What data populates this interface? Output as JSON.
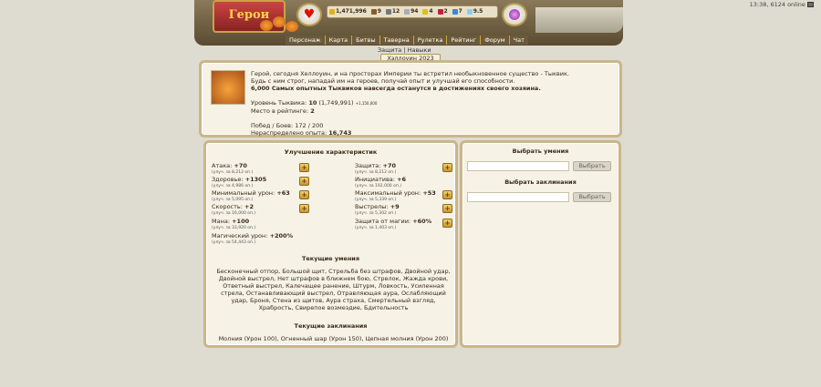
{
  "topbar": {
    "time_online": "13:38, 6124 online"
  },
  "header": {
    "logo_text": "Герои",
    "resources": [
      "1,471,996",
      "9",
      "12",
      "94",
      "4",
      "2",
      "7",
      "9.5"
    ]
  },
  "nav": [
    "Персонаж",
    "Карта",
    "Битвы",
    "Таверна",
    "Рулетка",
    "Рейтинг",
    "Форум",
    "Чат"
  ],
  "subnav": "Защита | Навыки",
  "page_title": "Хэллоуин 2023",
  "hero": {
    "line1": "Герой, сегодня Хеллоуин, и на просторах Империи ты встретил необыкновенное существо - Тыквик.",
    "line2": "Будь с ним строг, нападай им на героев, получай опыт и улучшай его способности.",
    "line3": "6,000 Самых опытных Тыквиков навсегда останутся в достижениях своего хозяина.",
    "level_label": "Уровень Тыквика:",
    "level_value": "10",
    "level_exp": "(1,749,991)",
    "level_next": "+1,150,000",
    "rank_label": "Место в рейтинге:",
    "rank_value": "2",
    "wins_label": "Побед / Боев:",
    "wins_value": "172 / 200",
    "unspent_label": "Нераспределено опыта:",
    "unspent_value": "16,743"
  },
  "upgrades": {
    "title": "Улучшение характеристик",
    "left": [
      {
        "label": "Атака:",
        "value": "+70",
        "cost": "(улуч. за 8,212 оп.)"
      },
      {
        "label": "Здоровье:",
        "value": "+1305",
        "cost": "(улуч. за 4,986 оп.)"
      },
      {
        "label": "Минимальный урон:",
        "value": "+63",
        "cost": "(улуч. за 5,095 оп.)"
      },
      {
        "label": "Скорость:",
        "value": "+2",
        "cost": "(улуч. за 16,000 оп.)"
      },
      {
        "label": "Мана:",
        "value": "+100",
        "cost": "(улуч. за 33,920 оп.)"
      },
      {
        "label": "Магический урон:",
        "value": "+200%",
        "cost": "(улуч. за 54,443 оп.)"
      }
    ],
    "right": [
      {
        "label": "Защита:",
        "value": "+70",
        "cost": "(улуч. за 8,212 оп.)"
      },
      {
        "label": "Инициатива:",
        "value": "+6",
        "cost": "(улуч. за 192,000 оп.)"
      },
      {
        "label": "Максимальный урон:",
        "value": "+53",
        "cost": "(улуч. за 5,339 оп.)"
      },
      {
        "label": "Выстрелы:",
        "value": "+9",
        "cost": "(улуч. за 5,302 оп.)"
      },
      {
        "label": "Защита от магии:",
        "value": "+60%",
        "cost": "(улуч. за 1,403 оп.)"
      }
    ],
    "plus": "+"
  },
  "skills": {
    "title": "Текущие умения",
    "text": "Бесконечный отпор, Большой щит, Стрельба без штрафов, Двойной удар, Двойной выстрел, Нет штрафов в ближнем бою, Стрелок, Жажда крови, Ответный выстрел, Калечащее ранение, Штурм, Ловкость, Усиленная стрела, Останавливающий выстрел, Отравляющая аура, Ослабляющий удар, Броня, Стена из щитов, Аура страха, Смертельный взгляд, Храбрость, Свирепое возмездие, Бдительность"
  },
  "spells": {
    "title": "Текущие заклинания",
    "text": "Молния (Урон 100), Огненный шар (Урон 150), Цепная молния (Урон 200)"
  },
  "choose": {
    "skill_title": "Выбрать умения",
    "spell_title": "Выбрать заклинания",
    "button": "Выбрать"
  }
}
